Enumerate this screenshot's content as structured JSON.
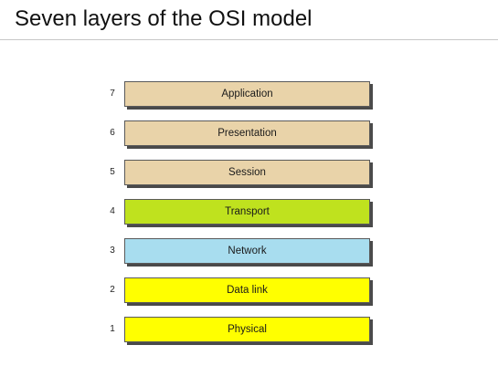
{
  "title": "Seven layers of the OSI model",
  "colors": {
    "upper_layers": "#e9d3a9",
    "transport": "#bfe21e",
    "network": "#a8ddef",
    "lower_layers": "#ffff00"
  },
  "layers": [
    {
      "number": "7",
      "name": "Application",
      "color": "#e9d3a9"
    },
    {
      "number": "6",
      "name": "Presentation",
      "color": "#e9d3a9"
    },
    {
      "number": "5",
      "name": "Session",
      "color": "#e9d3a9"
    },
    {
      "number": "4",
      "name": "Transport",
      "color": "#bfe21e"
    },
    {
      "number": "3",
      "name": "Network",
      "color": "#a8ddef"
    },
    {
      "number": "2",
      "name": "Data link",
      "color": "#ffff00"
    },
    {
      "number": "1",
      "name": "Physical",
      "color": "#ffff00"
    }
  ]
}
